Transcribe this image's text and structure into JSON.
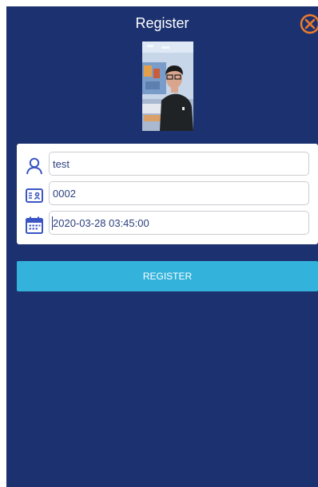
{
  "header": {
    "title": "Register",
    "close_icon": "close-circle-icon",
    "close_color": "#ee7a2a"
  },
  "photo": {
    "description_icon": "face-photo"
  },
  "form": {
    "name_icon": "user-icon",
    "name_value": "test",
    "id_icon": "id-card-icon",
    "id_value": "0002",
    "date_icon": "calendar-icon",
    "date_value": "2020-03-28 03:45:00"
  },
  "actions": {
    "register_label": "REGISTER",
    "register_color": "#33b3dc"
  },
  "theme": {
    "background": "#1c3270",
    "accent": "#3b55c4"
  }
}
